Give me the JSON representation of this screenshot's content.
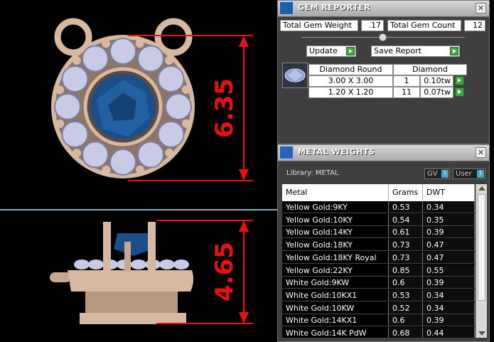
{
  "viewport": {
    "dimension_top": "6.35",
    "dimension_bottom": "4.65",
    "colors": {
      "dimension": "#e81010",
      "metal": "#d6b9a0",
      "sapphire": "#1a4f8a",
      "diamond": "#c9cbe6",
      "divider": "#b8dff5"
    }
  },
  "gem_reporter": {
    "title": "GEM REPORTER",
    "close_glyph": "✕",
    "total_gem_weight_label": "Total Gem Weight",
    "total_gem_weight_value": ".17",
    "total_gem_count_label": "Total Gem Count",
    "total_gem_count_value": "12",
    "update_label": "Update",
    "save_report_label": "Save Report",
    "table": {
      "headers": [
        "Diamond Round",
        "Diamond"
      ],
      "rows": [
        {
          "size": "3.00 X 3.00",
          "count": "1",
          "weight": "0.10tw"
        },
        {
          "size": "1.20 X 1.20",
          "count": "11",
          "weight": "0.07tw"
        }
      ]
    }
  },
  "metal_weights": {
    "title": "METAL WEIGHTS",
    "close_glyph": "✕",
    "library_label": "Library: METAL",
    "gv_label": "GV",
    "user_label": "User",
    "toggle_glyph": "I",
    "columns": [
      "Metal",
      "Grams",
      "DWT"
    ],
    "rows": [
      {
        "metal": "Yellow Gold:9KY",
        "grams": "0.53",
        "dwt": "0.34"
      },
      {
        "metal": "Yellow Gold:10KY",
        "grams": "0.54",
        "dwt": "0.35"
      },
      {
        "metal": "Yellow Gold:14KY",
        "grams": "0.61",
        "dwt": "0.39"
      },
      {
        "metal": "Yellow Gold:18KY",
        "grams": "0.73",
        "dwt": "0.47"
      },
      {
        "metal": "Yellow Gold:18KY Royal",
        "grams": "0.73",
        "dwt": "0.47"
      },
      {
        "metal": "Yellow Gold:22KY",
        "grams": "0.85",
        "dwt": "0.55"
      },
      {
        "metal": "White Gold:9KW",
        "grams": "0.6",
        "dwt": "0.39"
      },
      {
        "metal": "White Gold:10KX1",
        "grams": "0.53",
        "dwt": "0.34"
      },
      {
        "metal": "White Gold:10KW",
        "grams": "0.52",
        "dwt": "0.34"
      },
      {
        "metal": "White Gold:14KX1",
        "grams": "0.6",
        "dwt": "0.39"
      },
      {
        "metal": "White Gold:14K PdW",
        "grams": "0.68",
        "dwt": "0.44"
      }
    ]
  }
}
